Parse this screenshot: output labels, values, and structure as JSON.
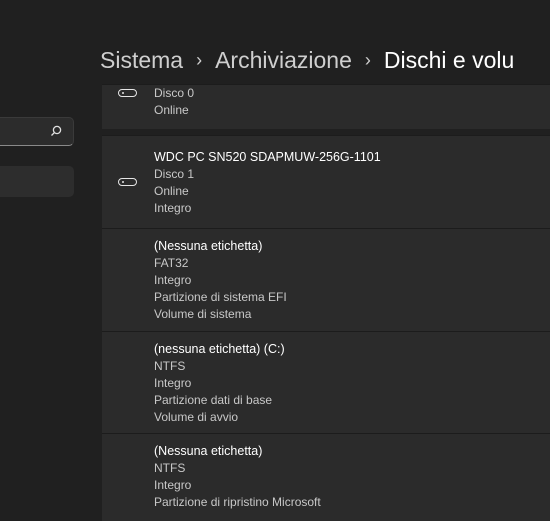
{
  "breadcrumb": {
    "item1": "Sistema",
    "item2": "Archiviazione",
    "item3": "Dischi e volu",
    "separator": "›"
  },
  "search": {
    "icon": "search-icon"
  },
  "disk0": {
    "lines": [
      "Disco 0",
      "Online"
    ]
  },
  "disk1": {
    "name": "WDC PC SN520 SDAPMUW-256G-1101",
    "lines": [
      "Disco 1",
      "Online",
      "Integro"
    ]
  },
  "volumes": [
    {
      "lines": [
        "(Nessuna etichetta)",
        "FAT32",
        "Integro",
        "Partizione di sistema EFI",
        "Volume di sistema"
      ]
    },
    {
      "lines": [
        "(nessuna etichetta) (C:)",
        "NTFS",
        "Integro",
        "Partizione dati di base",
        "Volume di avvio"
      ]
    },
    {
      "lines": [
        "(Nessuna etichetta)",
        "NTFS",
        "Integro",
        "Partizione di ripristino Microsoft"
      ]
    }
  ]
}
